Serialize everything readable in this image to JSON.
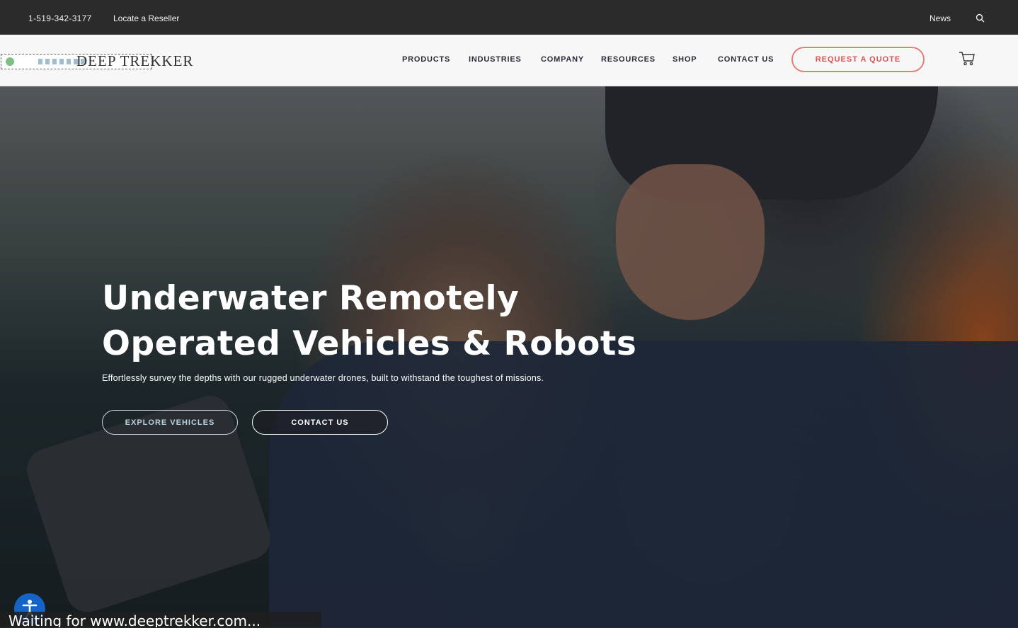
{
  "topbar": {
    "phone": "1-519-342-3177",
    "reseller_link": "Locate a Reseller",
    "news_link": "News",
    "search_icon": "search-icon"
  },
  "header": {
    "logo_text": "DEEP TREKKER",
    "nav": [
      "PRODUCTS",
      "INDUSTRIES",
      "COMPANY",
      "RESOURCES",
      "SHOP",
      "CONTACT US"
    ],
    "quote_button": "REQUEST A QUOTE",
    "cart_icon": "cart-icon"
  },
  "hero": {
    "title_line1": "Underwater Remotely",
    "title_line2": "Operated Vehicles & Robots",
    "subtitle": "Effortlessly survey the depths with our rugged underwater drones, built to withstand the toughest of missions.",
    "explore_button": "EXPLORE VEHICLES",
    "contact_button": "CONTACT US"
  },
  "accessibility": {
    "icon": "accessibility-icon"
  },
  "status": {
    "text": "Waiting for www.deeptrekker.com..."
  },
  "colors": {
    "topbar_bg": "#2b2b2b",
    "header_bg": "#f7f7f7",
    "accent": "#e97d78"
  }
}
